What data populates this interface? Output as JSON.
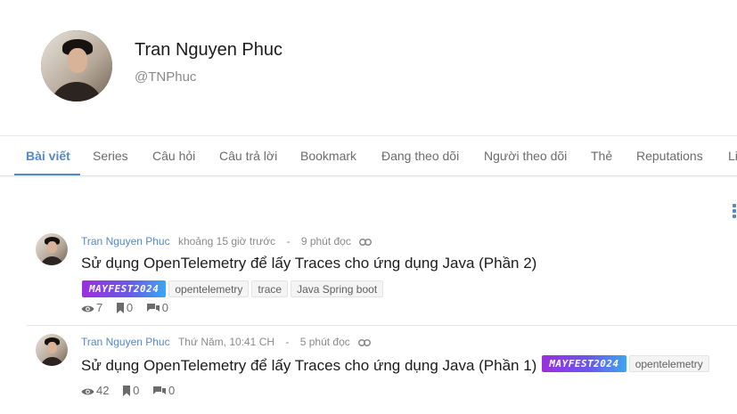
{
  "profile": {
    "name": "Tran Nguyen Phuc",
    "handle": "@TNPhuc"
  },
  "tabs": [
    {
      "label": "Bài viết",
      "active": true
    },
    {
      "label": "Series"
    },
    {
      "label": "Câu hỏi"
    },
    {
      "label": "Câu trả lời"
    },
    {
      "label": "Bookmark"
    },
    {
      "label": "Đang theo dõi"
    },
    {
      "label": "Người theo dõi"
    },
    {
      "label": "Thẻ"
    },
    {
      "label": "Reputations"
    },
    {
      "label": "Li"
    }
  ],
  "colors": {
    "accent": "#5488c7",
    "text": "#1b1b1b",
    "muted": "#8a8a8a"
  },
  "posts": [
    {
      "author": "Tran Nguyen Phuc",
      "time": "khoảng 15 giờ trước",
      "separator": "-",
      "read_time": "9 phút đọc",
      "title": "Sử dụng OpenTelemetry để lấy Traces cho ứng dụng Java (Phần 2)",
      "tags": [
        "MAYFEST2024",
        "opentelemetry",
        "trace",
        "Java Spring boot"
      ],
      "views": "7",
      "bookmarks": "0",
      "comments": "0"
    },
    {
      "author": "Tran Nguyen Phuc",
      "time": "Thứ Năm, 10:41 CH",
      "separator": "-",
      "read_time": "5 phút đọc",
      "title": "Sử dụng OpenTelemetry để lấy Traces cho ứng dụng Java (Phần 1)",
      "tags": [
        "MAYFEST2024",
        "opentelemetry"
      ],
      "views": "42",
      "bookmarks": "0",
      "comments": "0"
    }
  ],
  "icons": {
    "more": "more-vertical-icon",
    "link": "link-icon",
    "views": "eye-icon",
    "bookmarks": "bookmark-icon",
    "comments": "comments-icon"
  }
}
